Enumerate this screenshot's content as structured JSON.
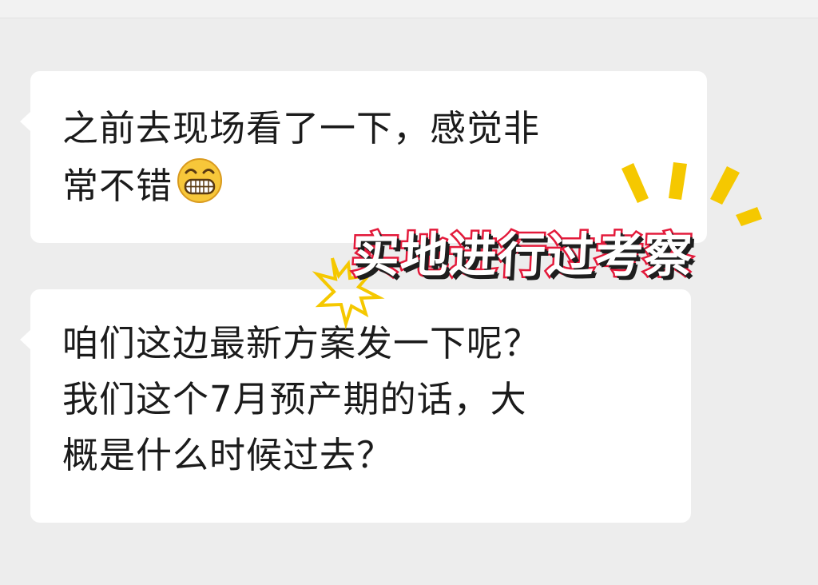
{
  "chat": {
    "messages": [
      {
        "lines": [
          "之前去现场看了一下，感觉非",
          "常不错"
        ],
        "emoji": "grinning-face-emoji"
      },
      {
        "lines": [
          "咱们这边最新方案发一下呢？",
          "我们这个7月预产期的话，大",
          "概是什么时候过去？"
        ]
      }
    ]
  },
  "overlay": {
    "banner_text": "实地进行过考察"
  },
  "colors": {
    "background": "#ededed",
    "bubble": "#ffffff",
    "text": "#1b1b1b",
    "banner_stroke": "#e3193a",
    "accent_yellow": "#f5c800"
  }
}
